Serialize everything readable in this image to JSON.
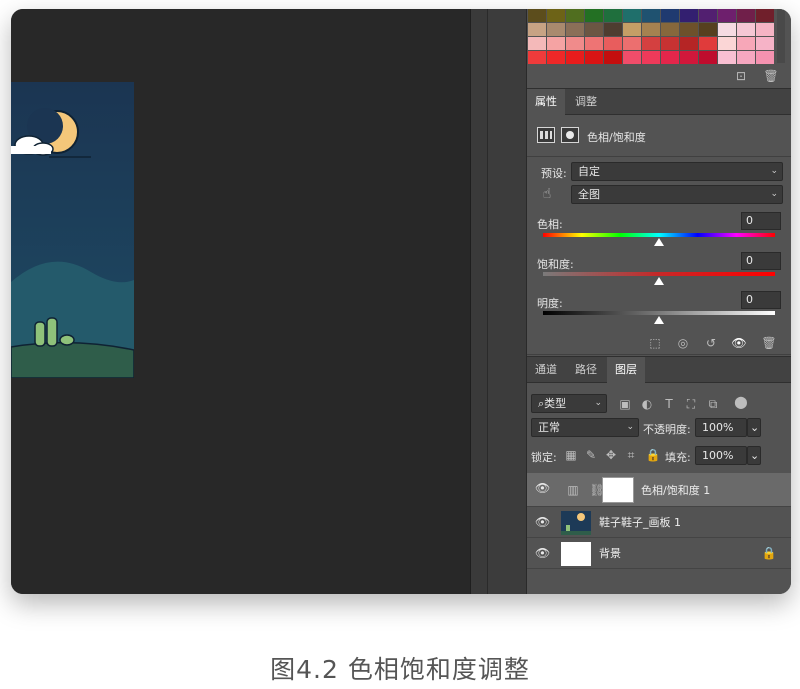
{
  "swatches": {
    "rows": [
      [
        "#5c4d1c",
        "#6d6317",
        "#506e1f",
        "#237023",
        "#1f6f3d",
        "#1f6f6b",
        "#1f5270",
        "#1f3a70",
        "#331f70",
        "#521f70",
        "#6e1f6d",
        "#701f4a",
        "#701f2b"
      ],
      [
        "#c7a384",
        "#a98a6e",
        "#8a6f58",
        "#6b5643",
        "#4e3d30",
        "#c49e66",
        "#a58250",
        "#86683c",
        "#6d512b",
        "#56401f",
        "#f5dbe2",
        "#f5c7d4",
        "#f5b4c4"
      ],
      [
        "#f4b9b9",
        "#f5a3a3",
        "#f08b8b",
        "#ee7474",
        "#e85d5d",
        "#ec6f6f",
        "#d44040",
        "#c73232",
        "#b52525",
        "#e03b3b",
        "#fbd6d6",
        "#f7a7b8",
        "#f6b3c7"
      ],
      [
        "#ef3b3b",
        "#ee2828",
        "#e81c1c",
        "#d91414",
        "#c40e0e",
        "#f04d6a",
        "#ee3a5a",
        "#e3264b",
        "#d1183b",
        "#bf0c2d",
        "#f9bfd2",
        "#f6a7c0",
        "#f592b0"
      ]
    ]
  },
  "properties_panel": {
    "tabs": [
      "属性",
      "调整"
    ],
    "active_tab": "属性",
    "adjustment_title": "色相/饱和度",
    "preset_label": "预设:",
    "preset_value": "自定",
    "range_value": "全图",
    "hue_label": "色相:",
    "hue_value": "0",
    "saturation_label": "饱和度:",
    "saturation_value": "0",
    "lightness_label": "明度:",
    "lightness_value": "0"
  },
  "layers_panel": {
    "tabs": [
      "通道",
      "路径",
      "图层"
    ],
    "active_tab": "图层",
    "filter_label": "类型",
    "blend_mode": "正常",
    "opacity_label": "不透明度:",
    "opacity_value": "100%",
    "lock_label": "锁定:",
    "fill_label": "填充:",
    "fill_value": "100%",
    "layers": [
      {
        "name": "色相/饱和度 1",
        "selected": true
      },
      {
        "name": "鞋子鞋子_画板 1",
        "selected": false
      },
      {
        "name": "背景",
        "selected": false
      }
    ]
  },
  "caption": "图4.2  色相饱和度调整",
  "colors": {
    "panel_bg": "#535353",
    "canvas_bg": "#282828",
    "artboard_sky": "#1d3a57"
  }
}
